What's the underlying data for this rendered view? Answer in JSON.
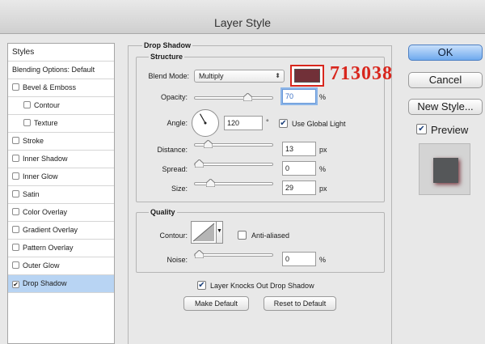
{
  "window": {
    "title": "Layer Style"
  },
  "styles_list": {
    "header": "Styles",
    "items": [
      {
        "label": "Blending Options: Default",
        "checkbox": false,
        "indent": 0,
        "checked": false,
        "selected": false
      },
      {
        "label": "Bevel & Emboss",
        "checkbox": true,
        "indent": 0,
        "checked": false,
        "selected": false
      },
      {
        "label": "Contour",
        "checkbox": true,
        "indent": 1,
        "checked": false,
        "selected": false
      },
      {
        "label": "Texture",
        "checkbox": true,
        "indent": 1,
        "checked": false,
        "selected": false
      },
      {
        "label": "Stroke",
        "checkbox": true,
        "indent": 0,
        "checked": false,
        "selected": false
      },
      {
        "label": "Inner Shadow",
        "checkbox": true,
        "indent": 0,
        "checked": false,
        "selected": false
      },
      {
        "label": "Inner Glow",
        "checkbox": true,
        "indent": 0,
        "checked": false,
        "selected": false
      },
      {
        "label": "Satin",
        "checkbox": true,
        "indent": 0,
        "checked": false,
        "selected": false
      },
      {
        "label": "Color Overlay",
        "checkbox": true,
        "indent": 0,
        "checked": false,
        "selected": false
      },
      {
        "label": "Gradient Overlay",
        "checkbox": true,
        "indent": 0,
        "checked": false,
        "selected": false
      },
      {
        "label": "Pattern Overlay",
        "checkbox": true,
        "indent": 0,
        "checked": false,
        "selected": false
      },
      {
        "label": "Outer Glow",
        "checkbox": true,
        "indent": 0,
        "checked": false,
        "selected": false
      },
      {
        "label": "Drop Shadow",
        "checkbox": true,
        "indent": 0,
        "checked": true,
        "selected": true
      }
    ]
  },
  "drop_shadow": {
    "title": "Drop Shadow",
    "structure": {
      "title": "Structure",
      "blend_mode_label": "Blend Mode:",
      "blend_mode_value": "Multiply",
      "shadow_color": "#713038",
      "color_annotation": "713038",
      "opacity_label": "Opacity:",
      "opacity_value": "70",
      "opacity_unit": "%",
      "angle_label": "Angle:",
      "angle_value": "120",
      "angle_unit": "°",
      "use_global_light_label": "Use Global Light",
      "use_global_light_checked": true,
      "distance_label": "Distance:",
      "distance_value": "13",
      "distance_unit": "px",
      "spread_label": "Spread:",
      "spread_value": "0",
      "spread_unit": "%",
      "size_label": "Size:",
      "size_value": "29",
      "size_unit": "px",
      "slider_levels": {
        "opacity": 0.7,
        "distance": 0.13,
        "spread": 0.0,
        "size": 0.16
      }
    },
    "quality": {
      "title": "Quality",
      "contour_label": "Contour:",
      "anti_aliased_label": "Anti-aliased",
      "anti_aliased_checked": false,
      "noise_label": "Noise:",
      "noise_value": "0",
      "noise_unit": "%",
      "noise_level": 0.0
    },
    "layer_knocks_out_label": "Layer Knocks Out Drop Shadow",
    "layer_knocks_out_checked": true,
    "make_default_label": "Make Default",
    "reset_to_default_label": "Reset to Default"
  },
  "buttons": {
    "ok_label": "OK",
    "cancel_label": "Cancel",
    "new_style_label": "New Style...",
    "preview_label": "Preview",
    "preview_checked": true
  },
  "colors": {
    "selection": "#b8d4f3",
    "annotation_red": "#d8261d",
    "preview_square": "#555759"
  },
  "icons": {
    "checkmark": "checkmark-icon",
    "select_arrows": "up-down-arrows-icon",
    "slider_thumb": "slider-thumb-icon",
    "angle_dial": "angle-dial-icon",
    "contour_curve": "contour-curve-icon"
  }
}
